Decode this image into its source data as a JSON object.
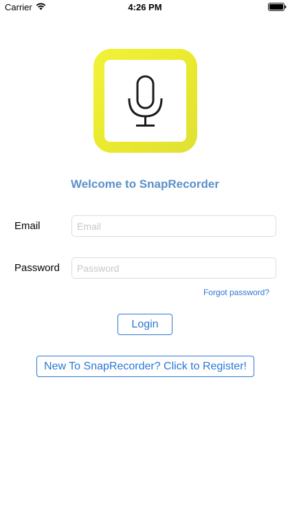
{
  "status_bar": {
    "carrier": "Carrier",
    "time": "4:26 PM",
    "icons": [
      "wifi-icon",
      "battery-icon"
    ]
  },
  "logo": {
    "icon": "microphone-icon",
    "frame_color": "#eeee33"
  },
  "welcome_text": "Welcome to SnapRecorder",
  "form": {
    "email_label": "Email",
    "email_placeholder": "Email",
    "email_value": "",
    "password_label": "Password",
    "password_placeholder": "Password",
    "password_value": "",
    "forgot_password": "Forgot password?"
  },
  "buttons": {
    "login": "Login",
    "register": "New To SnapRecorder? Click to Register!"
  },
  "colors": {
    "accent": "#2a77d4",
    "welcome": "#5b8fc9"
  }
}
